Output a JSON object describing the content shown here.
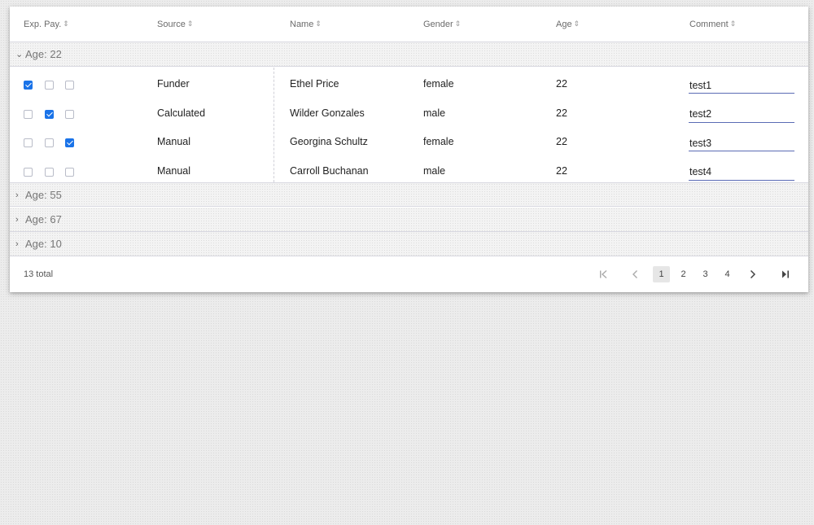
{
  "columns": [
    {
      "label": "Exp. Pay."
    },
    {
      "label": "Source"
    },
    {
      "label": "Name"
    },
    {
      "label": "Gender"
    },
    {
      "label": "Age"
    },
    {
      "label": "Comment"
    }
  ],
  "groups": [
    {
      "label": "Age: 22",
      "expanded": true
    },
    {
      "label": "Age: 55",
      "expanded": false
    },
    {
      "label": "Age: 67",
      "expanded": false
    },
    {
      "label": "Age: 10",
      "expanded": false
    }
  ],
  "rows": [
    {
      "checks": [
        true,
        false,
        false
      ],
      "source": "Funder",
      "name": "Ethel Price",
      "gender": "female",
      "age": "22",
      "comment": "test1"
    },
    {
      "checks": [
        false,
        true,
        false
      ],
      "source": "Calculated",
      "name": "Wilder Gonzales",
      "gender": "male",
      "age": "22",
      "comment": "test2"
    },
    {
      "checks": [
        false,
        false,
        true
      ],
      "source": "Manual",
      "name": "Georgina Schultz",
      "gender": "female",
      "age": "22",
      "comment": "test3"
    },
    {
      "checks": [
        false,
        false,
        false
      ],
      "source": "Manual",
      "name": "Carroll Buchanan",
      "gender": "male",
      "age": "22",
      "comment": "test4"
    }
  ],
  "footer": {
    "total": "13 total",
    "pages": [
      "1",
      "2",
      "3",
      "4"
    ],
    "current_page": "1"
  },
  "colors": {
    "accent": "#1a73e8",
    "input_underline": "#5b6bb5"
  },
  "icons": {
    "sort": "sort-icon",
    "expand": "chevron-down-icon",
    "collapse": "chevron-right-icon",
    "first": "first-page-icon",
    "prev": "prev-page-icon",
    "next": "next-page-icon",
    "last": "last-page-icon"
  }
}
